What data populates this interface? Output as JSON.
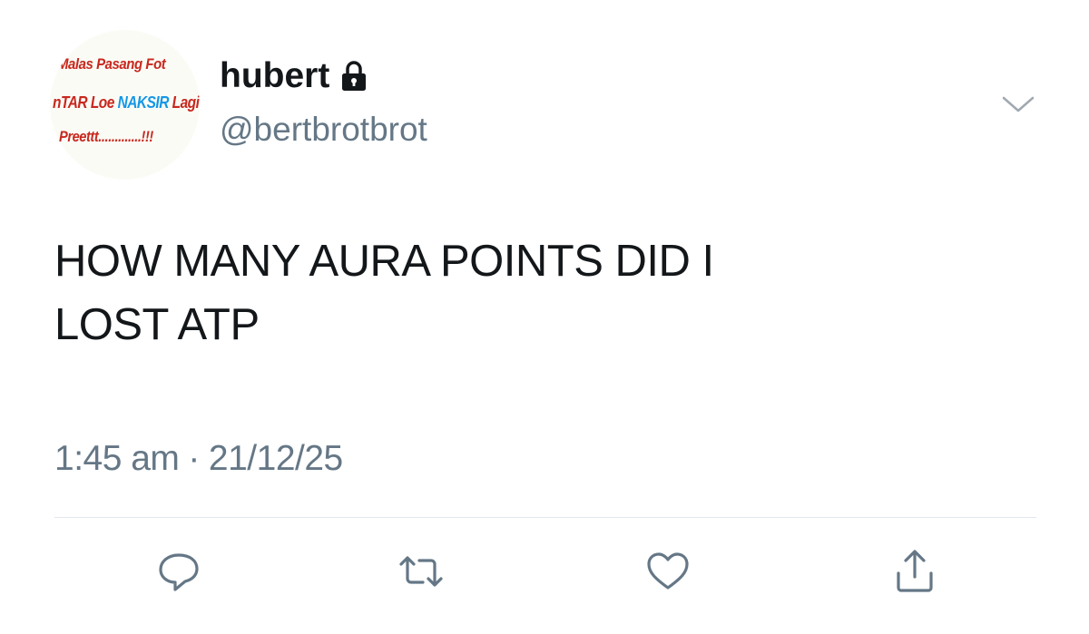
{
  "user": {
    "display_name": "hubert",
    "handle": "@bertbrotbrot",
    "avatar_text": {
      "line1": "Malas Pasang Fot",
      "line2_prefix": "nTAR Loe ",
      "line2_highlight": "NAKSIR",
      "line2_suffix": " Lagi",
      "line3": "Preettt.............!!!"
    }
  },
  "tweet": {
    "text_line1": "HOW MANY AURA POINTS DID I",
    "text_line2": "LOST ATP",
    "time": "1:45 am",
    "separator": "·",
    "date": "21/12/25"
  },
  "icons": {
    "lock": "lock-icon",
    "caret": "chevron-down-icon",
    "reply": "reply-icon",
    "retweet": "retweet-icon",
    "like": "heart-icon",
    "share": "share-icon"
  },
  "colors": {
    "text": "#14171a",
    "secondary": "#657786",
    "divider": "#e1e8ed",
    "avatar_red": "#c8281e",
    "avatar_blue": "#1597e6"
  }
}
